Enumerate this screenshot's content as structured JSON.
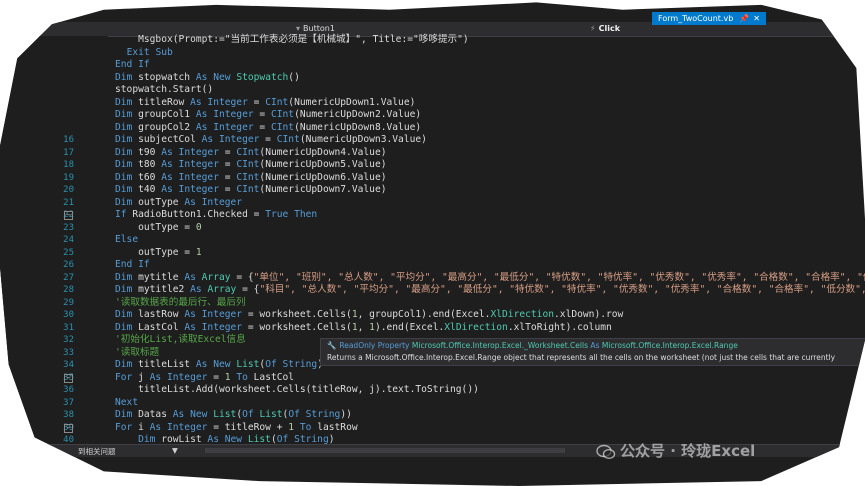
{
  "editor": {
    "nav": {
      "object_dropdown": "Button1",
      "event_dropdown": "Click"
    },
    "tab": {
      "filename": "Form_TwoCount.vb",
      "pin_glyph": "📌",
      "close_glyph": "✕"
    },
    "status": {
      "left": "到相关问题",
      "mid": "▼"
    }
  },
  "tooltip": {
    "kind": "ReadOnly Property",
    "signature_a": "Microsoft.Office.Interop.Excel._Worksheet.Cells",
    "signature_as": "As",
    "signature_type": "Microsoft.Office.Interop.Excel.Range",
    "description": "Returns a Microsoft.Office.Interop.Excel.Range object that represents all the cells on the worksheet (not just the cells that are currently"
  },
  "watermark": {
    "text": "公众号 · 玲珑Excel"
  },
  "code_lines": [
    {
      "n": "",
      "fold": "",
      "segs": [
        [
          "plain",
          "    Msgbox(Prompt:=\"当前工作表必须是【机械城】\", Title:=\"哆哆提示\")"
        ]
      ]
    },
    {
      "n": "",
      "fold": "",
      "segs": [
        [
          "plain",
          "  "
        ],
        [
          "kw",
          "Exit Sub"
        ]
      ]
    },
    {
      "n": "",
      "fold": "",
      "segs": [
        [
          "kw",
          "End If"
        ]
      ]
    },
    {
      "n": "",
      "fold": "",
      "segs": [
        [
          "kw",
          "Dim"
        ],
        [
          "plain",
          " stopwatch "
        ],
        [
          "kw",
          "As New"
        ],
        [
          "plain",
          " "
        ],
        [
          "tp",
          "Stopwatch"
        ],
        [
          "plain",
          "()"
        ]
      ]
    },
    {
      "n": "",
      "fold": "",
      "segs": [
        [
          "plain",
          "stopwatch.Start()"
        ]
      ]
    },
    {
      "n": "",
      "fold": "",
      "segs": [
        [
          "kw",
          "Dim"
        ],
        [
          "plain",
          " titleRow "
        ],
        [
          "kw",
          "As Integer"
        ],
        [
          "plain",
          " = "
        ],
        [
          "kw",
          "CInt"
        ],
        [
          "plain",
          "(NumericUpDown1.Value)"
        ]
      ]
    },
    {
      "n": "",
      "fold": "",
      "segs": [
        [
          "kw",
          "Dim"
        ],
        [
          "plain",
          " groupCol1 "
        ],
        [
          "kw",
          "As Integer"
        ],
        [
          "plain",
          " = "
        ],
        [
          "kw",
          "CInt"
        ],
        [
          "plain",
          "(NumericUpDown2.Value)"
        ]
      ]
    },
    {
      "n": "",
      "fold": "",
      "segs": [
        [
          "kw",
          "Dim"
        ],
        [
          "plain",
          " groupCol2 "
        ],
        [
          "kw",
          "As Integer"
        ],
        [
          "plain",
          " = "
        ],
        [
          "kw",
          "CInt"
        ],
        [
          "plain",
          "(NumericUpDown8.Value)"
        ]
      ]
    },
    {
      "n": "16",
      "fold": "",
      "segs": [
        [
          "kw",
          "Dim"
        ],
        [
          "plain",
          " subjectCol "
        ],
        [
          "kw",
          "As Integer"
        ],
        [
          "plain",
          " = "
        ],
        [
          "kw",
          "CInt"
        ],
        [
          "plain",
          "(NumericUpDown3.Value)"
        ]
      ]
    },
    {
      "n": "17",
      "fold": "",
      "segs": [
        [
          "kw",
          "Dim"
        ],
        [
          "plain",
          " t90 "
        ],
        [
          "kw",
          "As Integer"
        ],
        [
          "plain",
          " = "
        ],
        [
          "kw",
          "CInt"
        ],
        [
          "plain",
          "(NumericUpDown4.Value)"
        ]
      ]
    },
    {
      "n": "18",
      "fold": "",
      "segs": [
        [
          "kw",
          "Dim"
        ],
        [
          "plain",
          " t80 "
        ],
        [
          "kw",
          "As Integer"
        ],
        [
          "plain",
          " = "
        ],
        [
          "kw",
          "CInt"
        ],
        [
          "plain",
          "(NumericUpDown5.Value)"
        ]
      ]
    },
    {
      "n": "19",
      "fold": "",
      "segs": [
        [
          "kw",
          "Dim"
        ],
        [
          "plain",
          " t60 "
        ],
        [
          "kw",
          "As Integer"
        ],
        [
          "plain",
          " = "
        ],
        [
          "kw",
          "CInt"
        ],
        [
          "plain",
          "(NumericUpDown6.Value)"
        ]
      ]
    },
    {
      "n": "20",
      "fold": "",
      "segs": [
        [
          "kw",
          "Dim"
        ],
        [
          "plain",
          " t40 "
        ],
        [
          "kw",
          "As Integer"
        ],
        [
          "plain",
          " = "
        ],
        [
          "kw",
          "CInt"
        ],
        [
          "plain",
          "(NumericUpDown7.Value)"
        ]
      ]
    },
    {
      "n": "21",
      "fold": "",
      "segs": [
        [
          "kw",
          "Dim"
        ],
        [
          "plain",
          " outType "
        ],
        [
          "kw",
          "As Integer"
        ]
      ]
    },
    {
      "n": "22",
      "fold": "−",
      "segs": [
        [
          "kw",
          "If"
        ],
        [
          "plain",
          " RadioButton1.Checked = "
        ],
        [
          "kw",
          "True Then"
        ]
      ]
    },
    {
      "n": "23",
      "fold": "",
      "segs": [
        [
          "plain",
          "    outType = "
        ],
        [
          "num",
          "0"
        ]
      ]
    },
    {
      "n": "24",
      "fold": "",
      "segs": [
        [
          "kw",
          "Else"
        ]
      ]
    },
    {
      "n": "25",
      "fold": "",
      "segs": [
        [
          "plain",
          "    outType = "
        ],
        [
          "num",
          "1"
        ]
      ]
    },
    {
      "n": "26",
      "fold": "",
      "segs": [
        [
          "kw",
          "End If"
        ]
      ]
    },
    {
      "n": "27",
      "fold": "",
      "segs": [
        [
          "kw",
          "Dim"
        ],
        [
          "plain",
          " mytitle "
        ],
        [
          "kw",
          "As"
        ],
        [
          "plain",
          " "
        ],
        [
          "tp",
          "Array"
        ],
        [
          "plain",
          " = {"
        ],
        [
          "str",
          "\"单位\", \"班别\", \"总人数\", \"平均分\", \"最高分\", \"最低分\", \"特优数\", \"特优率\", \"优秀数\", \"优秀率\", \"合格数\", \"合格率\", \"低分数\""
        ]
      ]
    },
    {
      "n": "28",
      "fold": "",
      "segs": [
        [
          "kw",
          "Dim"
        ],
        [
          "plain",
          " mytitle2 "
        ],
        [
          "kw",
          "As"
        ],
        [
          "plain",
          " "
        ],
        [
          "tp",
          "Array"
        ],
        [
          "plain",
          " = {"
        ],
        [
          "str",
          "\"科目\", \"总人数\", \"平均分\", \"最高分\", \"最低分\", \"特优数\", \"特优率\", \"优秀数\", \"优秀率\", \"合格数\", \"合格率\", \"低分数\", \"低分"
        ]
      ]
    },
    {
      "n": "29",
      "fold": "",
      "segs": [
        [
          "cmt",
          "'读取数据表的最后行、最后列"
        ]
      ]
    },
    {
      "n": "30",
      "fold": "",
      "segs": [
        [
          "kw",
          "Dim"
        ],
        [
          "plain",
          " lastRow "
        ],
        [
          "kw",
          "As Integer"
        ],
        [
          "plain",
          " = worksheet.Cells("
        ],
        [
          "num",
          "1"
        ],
        [
          "plain",
          ", groupCol1).end(Excel."
        ],
        [
          "tp",
          "XlDirection"
        ],
        [
          "plain",
          ".xlDown).row"
        ]
      ]
    },
    {
      "n": "31",
      "fold": "",
      "segs": [
        [
          "kw",
          "Dim"
        ],
        [
          "plain",
          " LastCol "
        ],
        [
          "kw",
          "As Integer"
        ],
        [
          "plain",
          " = worksheet.Cells("
        ],
        [
          "num",
          "1"
        ],
        [
          "plain",
          ", "
        ],
        [
          "num",
          "1"
        ],
        [
          "plain",
          ").end(Excel."
        ],
        [
          "tp",
          "XlDirection"
        ],
        [
          "plain",
          ".xlToRight).column"
        ]
      ]
    },
    {
      "n": "32",
      "fold": "",
      "segs": [
        [
          "cmt",
          "'初始化List,读取Excel信息"
        ]
      ]
    },
    {
      "n": "33",
      "fold": "",
      "segs": [
        [
          "cmt",
          "'读取标题"
        ]
      ]
    },
    {
      "n": "34",
      "fold": "",
      "segs": [
        [
          "kw",
          "Dim"
        ],
        [
          "plain",
          " titleList "
        ],
        [
          "kw",
          "As New"
        ],
        [
          "plain",
          " "
        ],
        [
          "tp",
          "List"
        ],
        [
          "plain",
          "("
        ],
        [
          "kw",
          "Of String"
        ],
        [
          "plain",
          ")"
        ]
      ]
    },
    {
      "n": "35",
      "fold": "−",
      "segs": [
        [
          "kw",
          "For"
        ],
        [
          "plain",
          " j "
        ],
        [
          "kw",
          "As Integer"
        ],
        [
          "plain",
          " = "
        ],
        [
          "num",
          "1"
        ],
        [
          "plain",
          " "
        ],
        [
          "kw",
          "To"
        ],
        [
          "plain",
          " LastCol"
        ]
      ]
    },
    {
      "n": "36",
      "fold": "",
      "segs": [
        [
          "plain",
          "    titleList.Add(worksheet.Cells(titleRow, j).text.ToString())"
        ]
      ]
    },
    {
      "n": "37",
      "fold": "",
      "segs": [
        [
          "kw",
          "Next"
        ]
      ]
    },
    {
      "n": "38",
      "fold": "",
      "segs": [
        [
          "kw",
          "Dim"
        ],
        [
          "plain",
          " Datas "
        ],
        [
          "kw",
          "As New"
        ],
        [
          "plain",
          " "
        ],
        [
          "tp",
          "List"
        ],
        [
          "plain",
          "("
        ],
        [
          "kw",
          "Of"
        ],
        [
          "plain",
          " "
        ],
        [
          "tp",
          "List"
        ],
        [
          "plain",
          "("
        ],
        [
          "kw",
          "Of String"
        ],
        [
          "plain",
          "))"
        ]
      ]
    },
    {
      "n": "39",
      "fold": "−",
      "segs": [
        [
          "kw",
          "For"
        ],
        [
          "plain",
          " i "
        ],
        [
          "kw",
          "As Integer"
        ],
        [
          "plain",
          " = titleRow + "
        ],
        [
          "num",
          "1"
        ],
        [
          "plain",
          " "
        ],
        [
          "kw",
          "To"
        ],
        [
          "plain",
          " lastRow"
        ]
      ]
    },
    {
      "n": "40",
      "fold": "",
      "segs": [
        [
          "plain",
          "    "
        ],
        [
          "kw",
          "Dim"
        ],
        [
          "plain",
          " rowList "
        ],
        [
          "kw",
          "As New"
        ],
        [
          "plain",
          " "
        ],
        [
          "tp",
          "List"
        ],
        [
          "plain",
          "("
        ],
        [
          "kw",
          "Of String"
        ],
        [
          "plain",
          ")"
        ]
      ]
    }
  ]
}
